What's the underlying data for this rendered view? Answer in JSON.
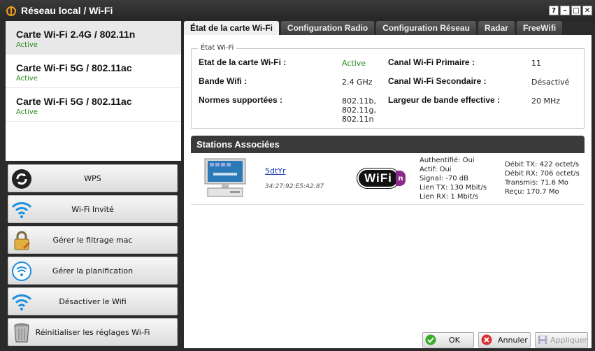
{
  "window": {
    "title": "Réseau local / Wi-Fi",
    "controls": [
      "?",
      "–",
      "□",
      "✕"
    ]
  },
  "networks": [
    {
      "name": "Carte Wi-Fi 2.4G / 802.11n",
      "status": "Active"
    },
    {
      "name": "Carte Wi-Fi 5G / 802.11ac",
      "status": "Active"
    },
    {
      "name": "Carte Wi-Fi 5G / 802.11ac",
      "status": "Active"
    }
  ],
  "actions": [
    {
      "label": "WPS",
      "icon": "wps-icon"
    },
    {
      "label": "Wi-Fi Invité",
      "icon": "wifi-guest-icon"
    },
    {
      "label": "Gérer le filtrage mac",
      "icon": "lock-icon"
    },
    {
      "label": "Gérer la planification",
      "icon": "schedule-icon"
    },
    {
      "label": "Désactiver le Wifi",
      "icon": "wifi-icon"
    },
    {
      "label": "Réinitialiser les réglages Wi-Fi",
      "icon": "trash-icon"
    }
  ],
  "tabs": [
    "État de la carte Wi-Fi",
    "Configuration Radio",
    "Configuration Réseau",
    "Radar",
    "FreeWifi"
  ],
  "etat": {
    "legend": "État Wi-Fi",
    "etat_label": "Etat de la carte Wi-Fi :",
    "etat_value": "Active",
    "bande_label": "Bande Wifi :",
    "bande_value": "2.4 GHz",
    "normes_label": "Normes supportées :",
    "normes_value": [
      "802.11b,",
      "802.11g,",
      "802.11n"
    ],
    "canal1_label": "Canal Wi-Fi Primaire :",
    "canal1_value": "11",
    "canal2_label": "Canal Wi-Fi Secondaire :",
    "canal2_value": "Désactivé",
    "largeur_label": "Largeur de bande effective :",
    "largeur_value": "20 MHz"
  },
  "stations": {
    "title": "Stations Associées",
    "rows": [
      {
        "name": "5dtYr",
        "mac": "34:27:92:E5:A2:87",
        "badge": "WiFi",
        "badge_suffix": "n",
        "info1": [
          "Authentifié: Oui",
          "Actif: Oui",
          "Signal: -70 dB",
          "Lien TX: 130 Mbit/s",
          "Lien RX: 1 Mbit/s"
        ],
        "info2": [
          "Débit TX: 422 octet/s",
          "Débit RX: 706 octet/s",
          "Transmis: 71.6 Mo",
          "Reçu: 170.7 Mo"
        ]
      }
    ]
  },
  "buttons": {
    "ok": "OK",
    "cancel": "Annuler",
    "apply": "Appliquer"
  },
  "colors": {
    "active_green": "#2a8a1e",
    "link_blue": "#1a3fb0",
    "wifi_blue": "#1e8ee0",
    "dark_bg": "#2b2b2b"
  }
}
